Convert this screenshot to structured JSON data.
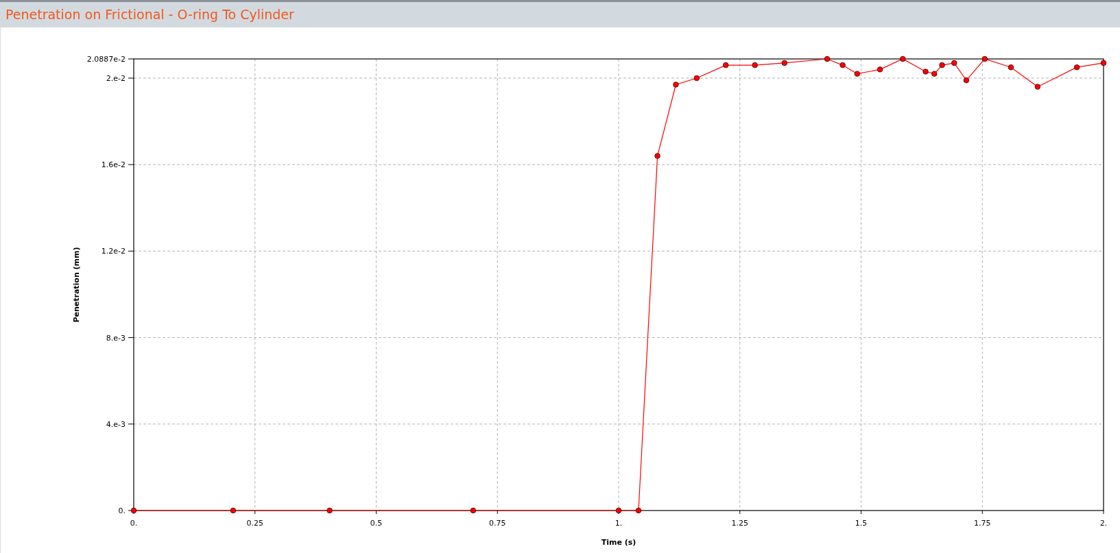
{
  "window": {
    "title": "Penetration on Frictional - O-ring To Cylinder"
  },
  "chart": {
    "chart_data": {
      "type": "line",
      "grid": true,
      "xlabel": "Time (s)",
      "ylabel": "Penetration (mm)",
      "xlim": [
        0,
        2
      ],
      "ylim": [
        0,
        0.020887
      ],
      "xticks": [
        {
          "value": 0,
          "label": "0."
        },
        0.25,
        0.5,
        0.75,
        {
          "value": 1,
          "label": "1."
        },
        1.25,
        1.5,
        1.75,
        {
          "value": 2,
          "label": "2."
        }
      ],
      "yticks": [
        {
          "value": 0,
          "label": "0."
        },
        {
          "value": 0.004,
          "label": "4.e-3"
        },
        {
          "value": 0.008,
          "label": "8.e-3"
        },
        {
          "value": 0.012,
          "label": "1.2e-2"
        },
        {
          "value": 0.016,
          "label": "1.6e-2"
        },
        {
          "value": 0.02,
          "label": "2.e-2"
        },
        {
          "value": 0.020887,
          "label": "2.0887e-2"
        }
      ],
      "x": [
        0,
        0.205,
        0.404,
        0.7,
        1.0,
        1.041,
        1.08,
        1.118,
        1.161,
        1.221,
        1.281,
        1.342,
        1.43,
        1.462,
        1.492,
        1.539,
        1.586,
        1.633,
        1.651,
        1.667,
        1.692,
        1.717,
        1.755,
        1.809,
        1.864,
        1.945,
        2.0
      ],
      "series": [
        {
          "color": "#ff0000",
          "marker": "circle",
          "values": [
            0,
            0,
            0,
            0,
            0,
            0,
            0.0164,
            0.0197,
            0.02,
            0.0206,
            0.0206,
            0.0207,
            0.020887,
            0.0206,
            0.0202,
            0.0204,
            0.020887,
            0.0203,
            0.0202,
            0.0206,
            0.0207,
            0.0199,
            0.020887,
            0.0205,
            0.0196,
            0.0205,
            0.0207
          ]
        }
      ]
    }
  }
}
